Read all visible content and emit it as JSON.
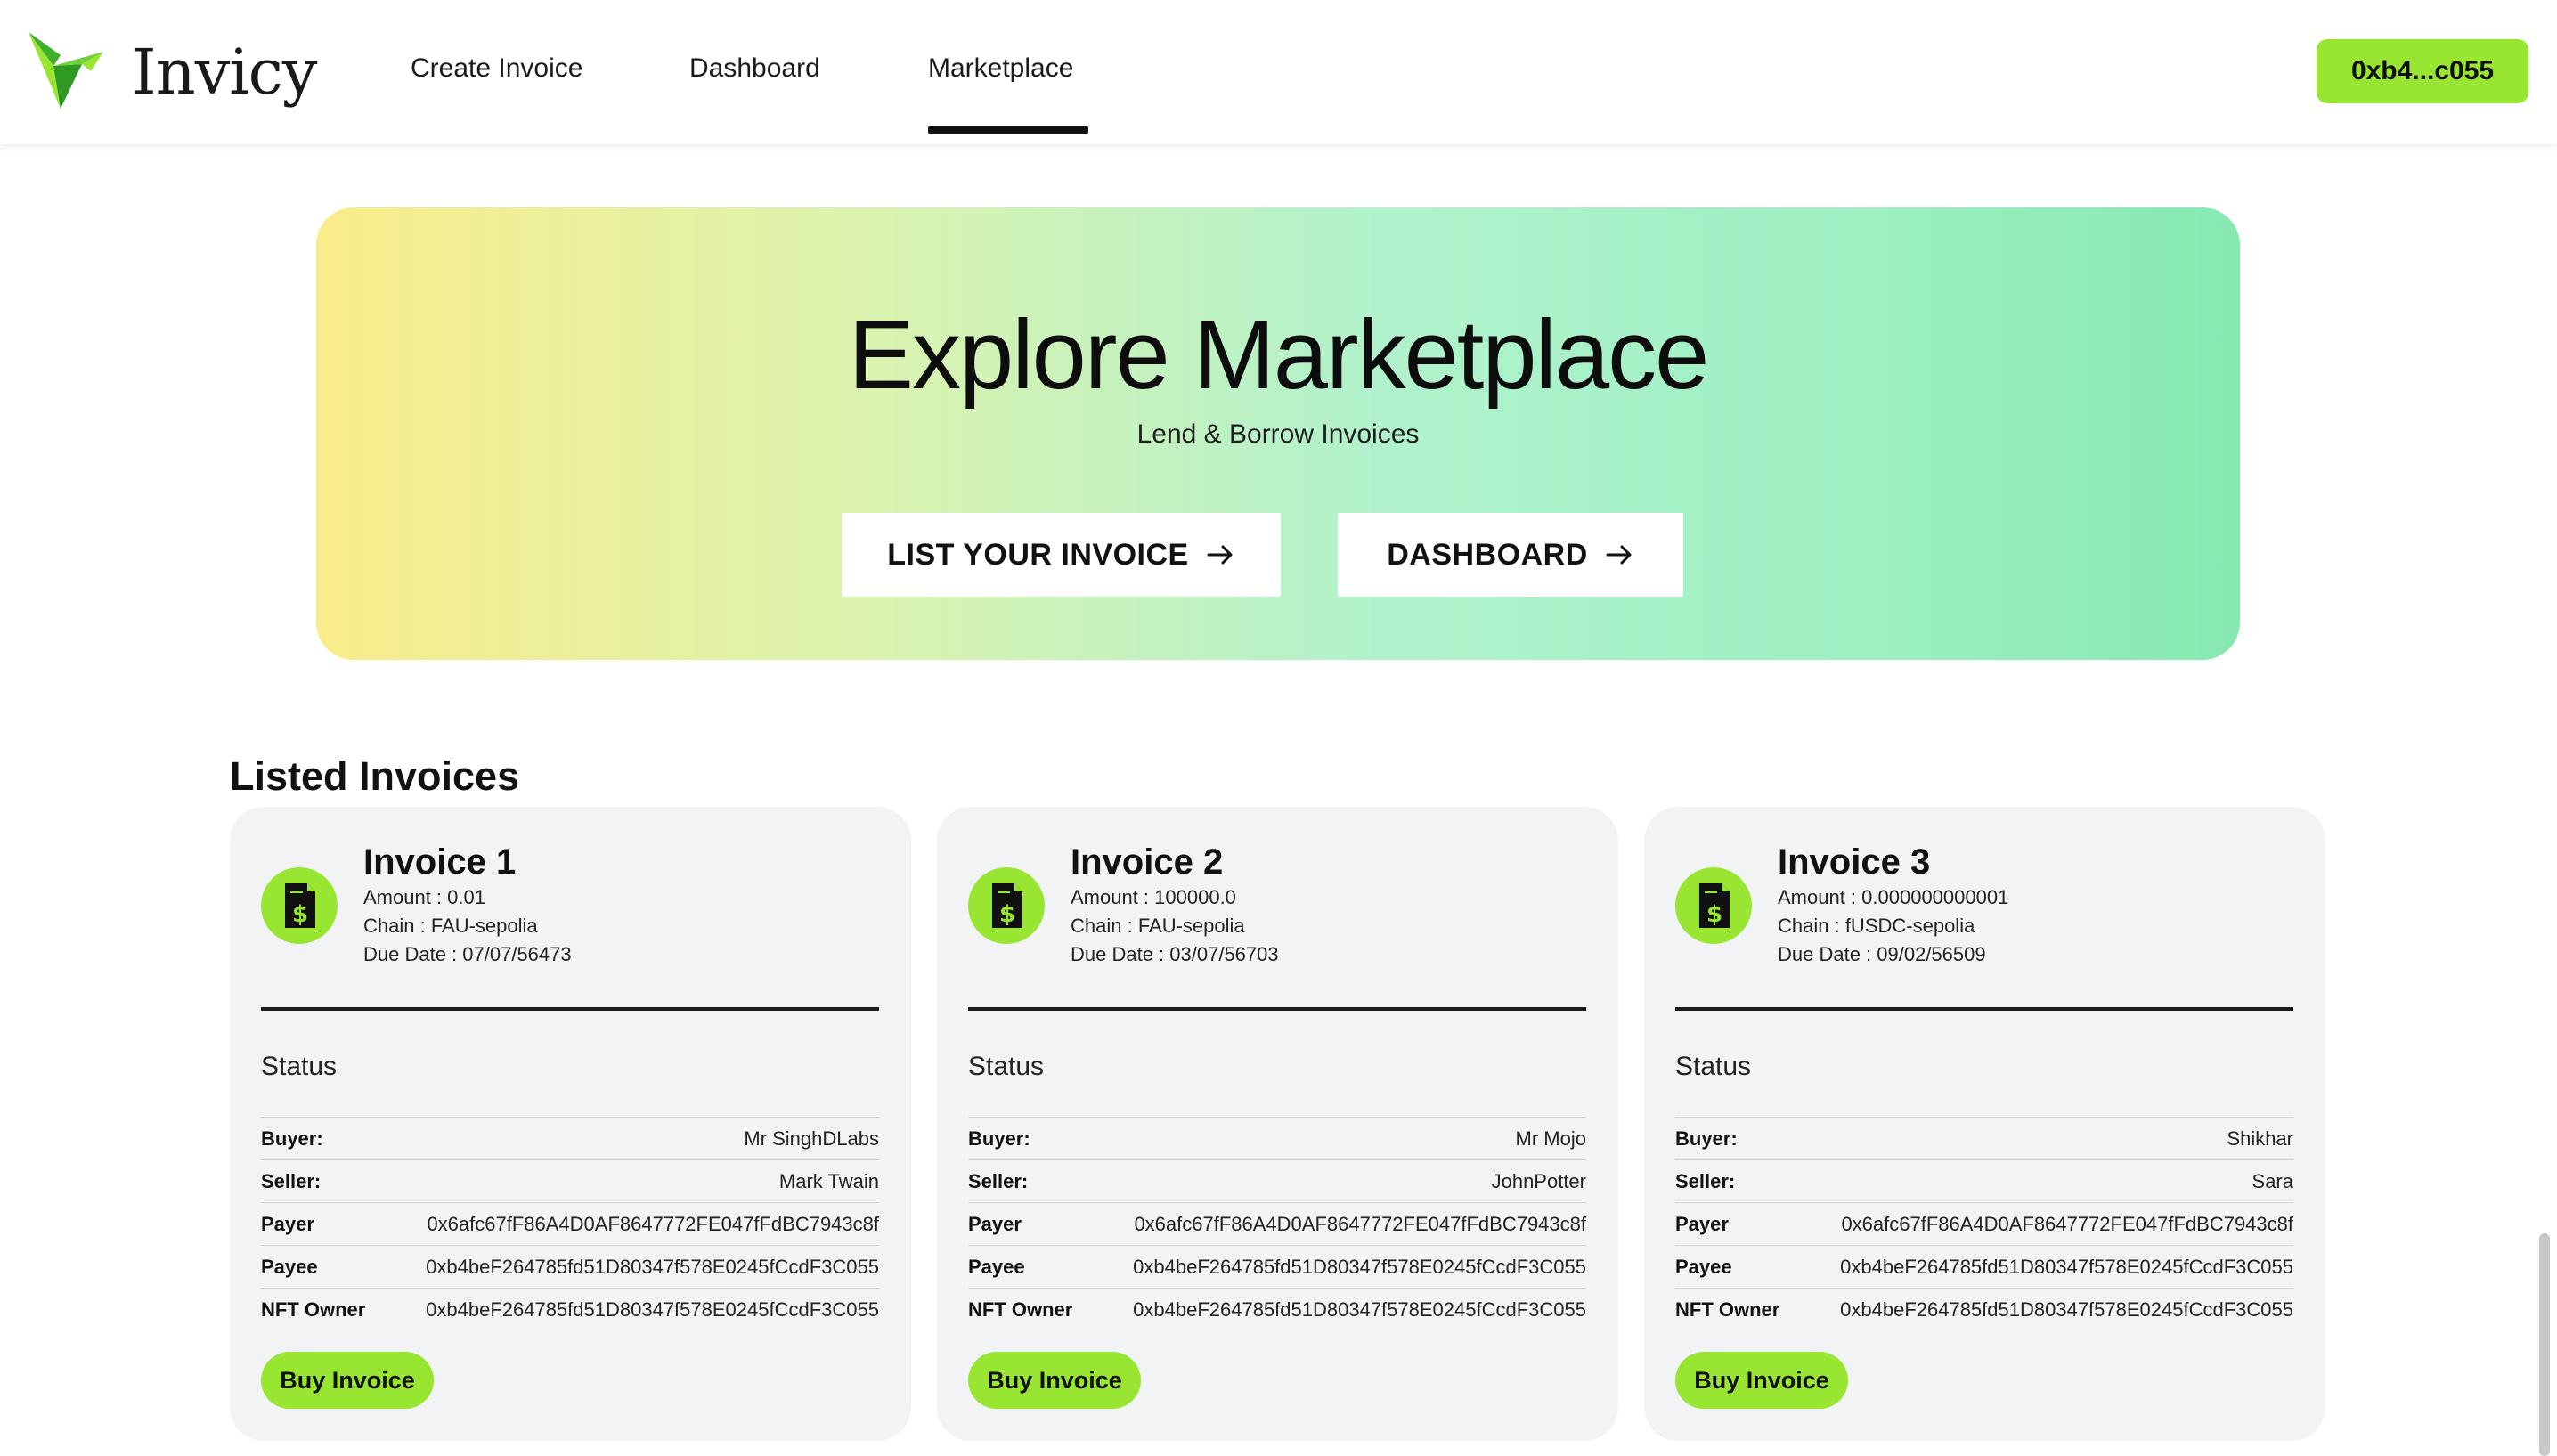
{
  "header": {
    "brand": "Invicy",
    "logo_icon": "bird-logo-icon",
    "nav": [
      {
        "label": "Create Invoice"
      },
      {
        "label": "Dashboard"
      },
      {
        "label": "Marketplace",
        "active": true
      }
    ],
    "wallet_label": "0xb4...c055",
    "accent_color": "#98e631"
  },
  "hero": {
    "title": "Explore Marketplace",
    "subtitle": "Lend & Borrow Invoices",
    "list_button": "LIST YOUR INVOICE",
    "dashboard_button": "DASHBOARD",
    "button_icon": "arrow-right-icon"
  },
  "listed": {
    "title": "Listed Invoices",
    "invoice_icon": "invoice-dollar-icon",
    "labels": {
      "status": "Status",
      "buyer": "Buyer:",
      "seller": "Seller:",
      "payer": "Payer",
      "payee": "Payee",
      "nft_owner": "NFT Owner",
      "buy_button": "Buy Invoice"
    },
    "invoices": [
      {
        "title": "Invoice 1",
        "amount": "Amount : 0.01",
        "chain": "Chain : FAU-sepolia",
        "due_date": "Due Date : 07/07/56473",
        "buyer": "Mr SinghDLabs",
        "seller": "Mark Twain",
        "payer": "0x6afc67fF86A4D0AF8647772FE047fFdBC7943c8f",
        "payee": "0xb4beF264785fd51D80347f578E0245fCcdF3C055",
        "nft_owner": "0xb4beF264785fd51D80347f578E0245fCcdF3C055"
      },
      {
        "title": "Invoice 2",
        "amount": "Amount : 100000.0",
        "chain": "Chain : FAU-sepolia",
        "due_date": "Due Date : 03/07/56703",
        "buyer": "Mr Mojo",
        "seller": "JohnPotter",
        "payer": "0x6afc67fF86A4D0AF8647772FE047fFdBC7943c8f",
        "payee": "0xb4beF264785fd51D80347f578E0245fCcdF3C055",
        "nft_owner": "0xb4beF264785fd51D80347f578E0245fCcdF3C055"
      },
      {
        "title": "Invoice 3",
        "amount": "Amount : 0.000000000001",
        "chain": "Chain : fUSDC-sepolia",
        "due_date": "Due Date : 09/02/56509",
        "buyer": "Shikhar",
        "seller": "Sara",
        "payer": "0x6afc67fF86A4D0AF8647772FE047fFdBC7943c8f",
        "payee": "0xb4beF264785fd51D80347f578E0245fCcdF3C055",
        "nft_owner": "0xb4beF264785fd51D80347f578E0245fCcdF3C055"
      }
    ]
  }
}
